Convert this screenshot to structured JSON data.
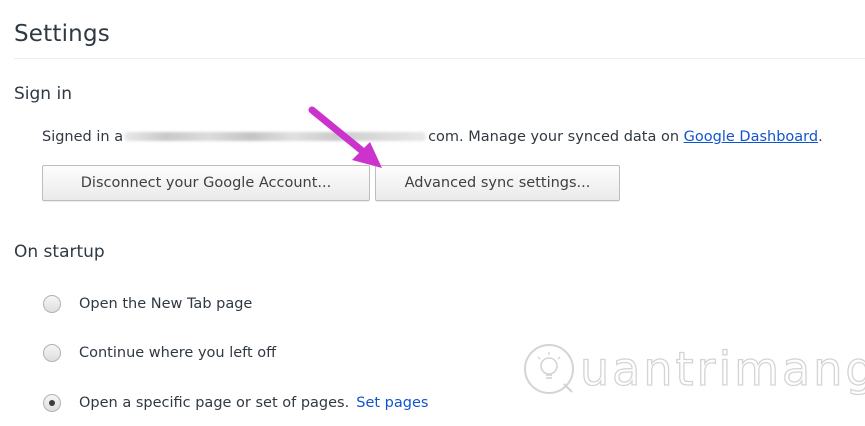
{
  "page": {
    "title": "Settings"
  },
  "sign_in": {
    "heading": "Sign in",
    "signed_in_prefix": "Signed in a",
    "email_suffix": "com.",
    "manage_text": "Manage your synced data on",
    "dashboard_link": "Google Dashboard",
    "dashboard_trailing": ".",
    "disconnect_button": "Disconnect your Google Account...",
    "advanced_button": "Advanced sync settings..."
  },
  "startup": {
    "heading": "On startup",
    "options": [
      {
        "label": "Open the New Tab page",
        "checked": false
      },
      {
        "label": "Continue where you left off",
        "checked": false
      },
      {
        "label": "Open a specific page or set of pages.",
        "checked": true
      }
    ],
    "set_pages_link": "Set pages"
  },
  "annotation": {
    "arrow_color": "#cc33cc"
  },
  "watermark": {
    "text": "uantrimang"
  },
  "colors": {
    "link": "#1155cc",
    "text": "#303942"
  }
}
